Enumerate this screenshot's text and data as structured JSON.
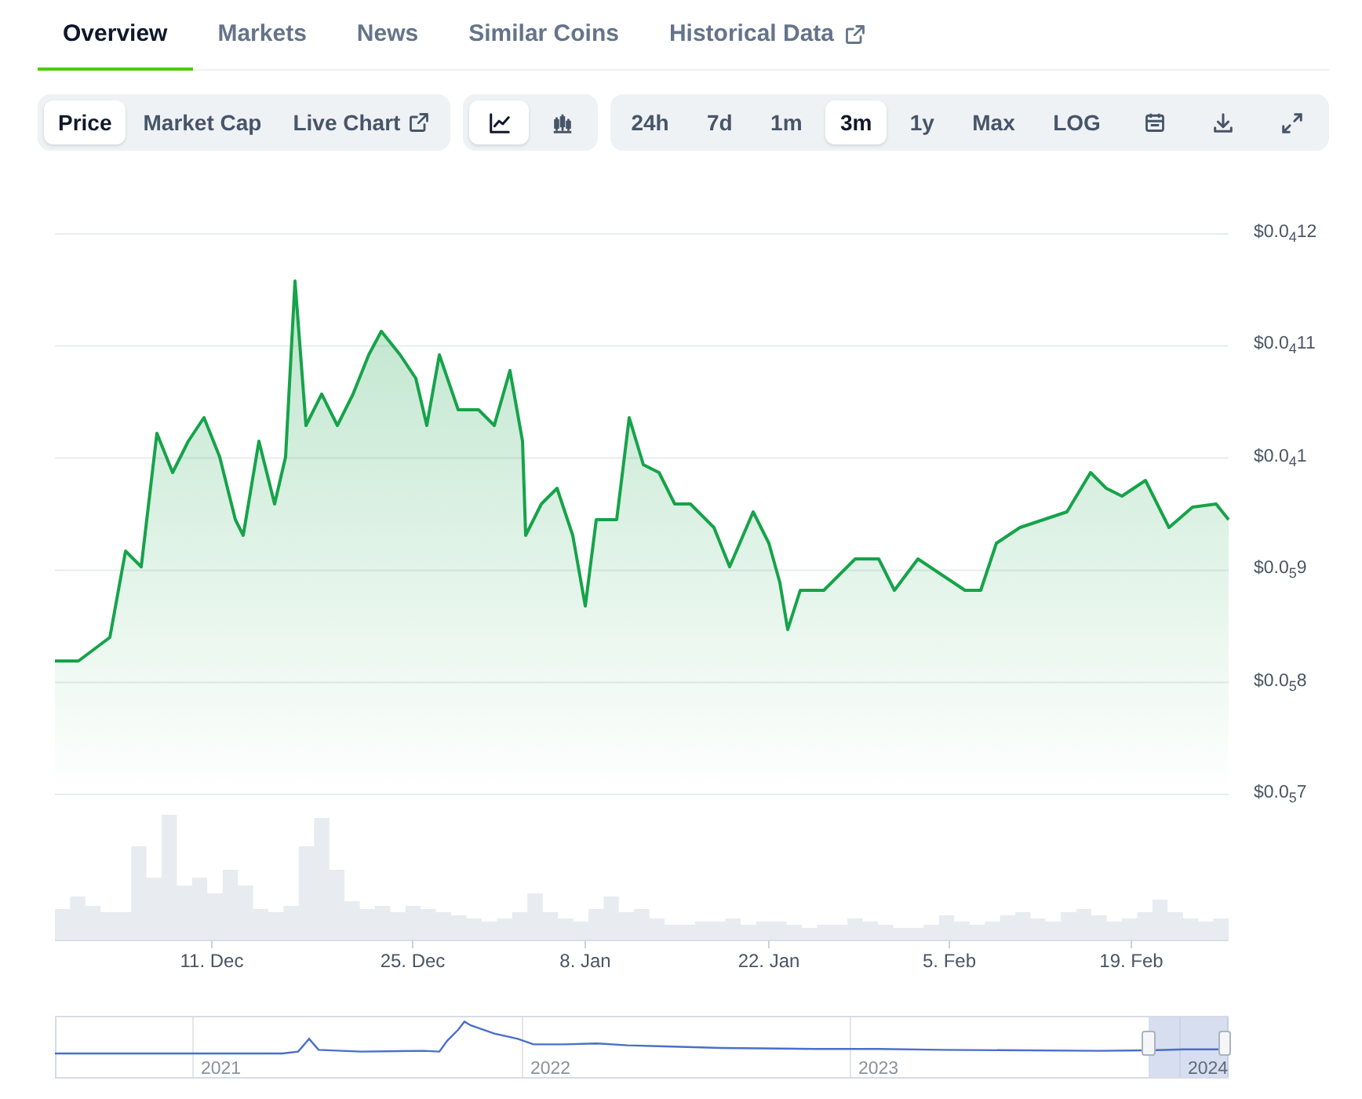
{
  "tabs": [
    {
      "label": "Overview",
      "selected": true,
      "external": false
    },
    {
      "label": "Markets",
      "selected": false,
      "external": false
    },
    {
      "label": "News",
      "selected": false,
      "external": false
    },
    {
      "label": "Similar Coins",
      "selected": false,
      "external": false
    },
    {
      "label": "Historical Data",
      "selected": false,
      "external": true
    }
  ],
  "toolbar": {
    "data_types": [
      {
        "label": "Price",
        "selected": true,
        "external": false
      },
      {
        "label": "Market Cap",
        "selected": false,
        "external": false
      },
      {
        "label": "Live Chart",
        "selected": false,
        "external": true
      }
    ],
    "chart_styles": [
      {
        "kind": "line",
        "selected": true
      },
      {
        "kind": "candles",
        "selected": false
      }
    ],
    "ranges": [
      {
        "label": "24h",
        "selected": false
      },
      {
        "label": "7d",
        "selected": false
      },
      {
        "label": "1m",
        "selected": false
      },
      {
        "label": "3m",
        "selected": true
      },
      {
        "label": "1y",
        "selected": false
      },
      {
        "label": "Max",
        "selected": false
      },
      {
        "label": "LOG",
        "selected": false
      }
    ],
    "actions": [
      {
        "kind": "calendar"
      },
      {
        "kind": "download"
      },
      {
        "kind": "expand"
      }
    ]
  },
  "price_chart": {
    "y_axis_labels": [
      "$0.0$_{4}$12",
      "$0.0$_{4}$11",
      "$0.0$_{4}$1",
      "$0.0$_{5}$9",
      "$0.0$_{5}$8",
      "$0.0$_{5}$7"
    ],
    "x_axis_labels": [
      "11. Dec",
      "25. Dec",
      "8. Jan",
      "22. Jan",
      "5. Feb",
      "19. Feb"
    ]
  },
  "navigator": {
    "labels": [
      "2021",
      "2022",
      "2023",
      "2024"
    ]
  }
}
